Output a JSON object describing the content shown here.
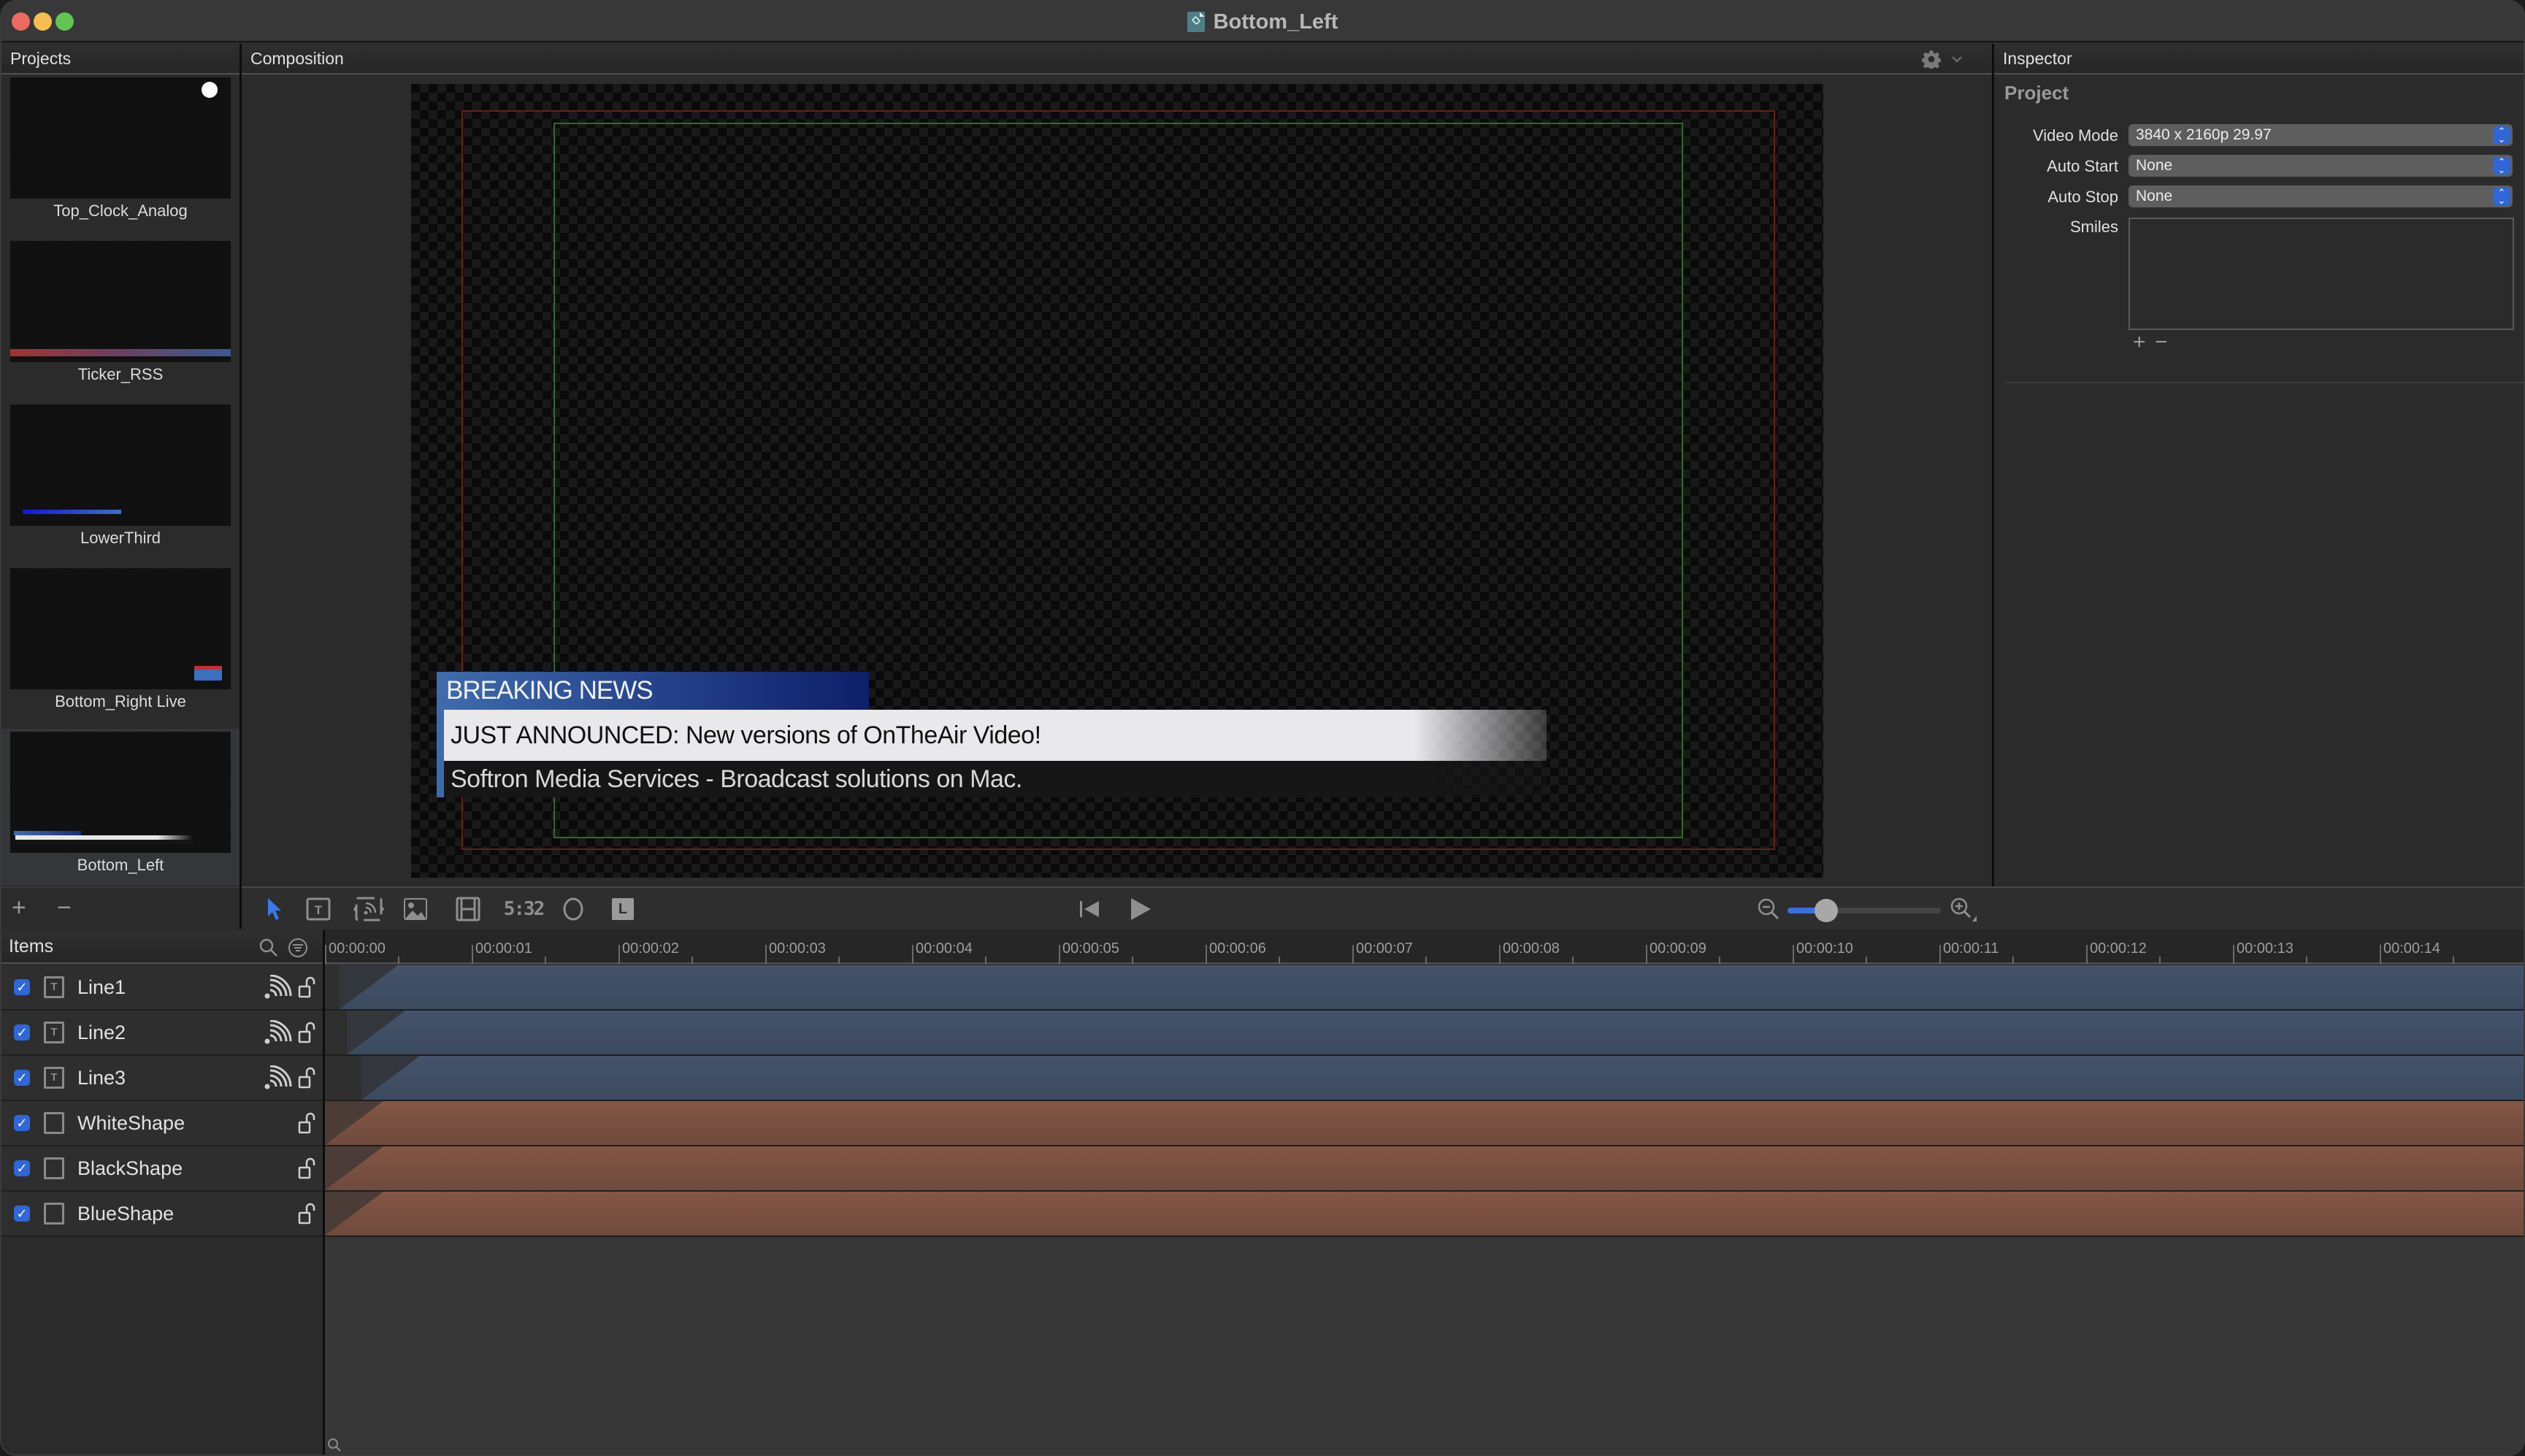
{
  "window": {
    "title": "Bottom_Left",
    "title_icon": "project-document-icon"
  },
  "panels": {
    "projects_header": "Projects",
    "composition_header": "Composition",
    "inspector_header": "Inspector"
  },
  "projects": {
    "items": [
      {
        "name": "Top_Clock_Analog",
        "thumbnail": "clock",
        "selected": false
      },
      {
        "name": "Ticker_RSS",
        "thumbnail": "ticker",
        "selected": false
      },
      {
        "name": "LowerThird",
        "thumbnail": "lowerthird",
        "selected": false
      },
      {
        "name": "Bottom_Right Live",
        "thumbnail": "live",
        "selected": false
      },
      {
        "name": "Bottom_Left",
        "thumbnail": "bottomleft",
        "selected": true
      }
    ],
    "add_label": "+",
    "remove_label": "−"
  },
  "composition": {
    "lower_third": {
      "title": "BREAKING NEWS",
      "line1": "JUST ANNOUNCED: New versions of OnTheAir Video!",
      "line2": "Softron Media Services -  Broadcast solutions on Mac."
    },
    "colors": {
      "safe_action": "#6b1c1c",
      "safe_title": "#2f6a26",
      "title_bar_blue": "#3f6cae"
    }
  },
  "toolbar": {
    "tools": [
      {
        "name": "select-tool",
        "icon": "arrow-pointer-icon",
        "active": true
      },
      {
        "name": "text-tool",
        "icon": "text-box-icon"
      },
      {
        "name": "rss-tool",
        "icon": "rss-feed-icon"
      },
      {
        "name": "image-tool",
        "icon": "image-icon"
      },
      {
        "name": "video-tool",
        "icon": "film-icon"
      },
      {
        "name": "clock-tool",
        "icon": "digital-clock-icon",
        "label": "5:32"
      },
      {
        "name": "shape-tool",
        "icon": "ellipse-icon"
      },
      {
        "name": "logo-tool",
        "icon": "l-badge-icon",
        "label": "L"
      }
    ],
    "transport": {
      "rewind": "skip-to-start-icon",
      "play": "play-icon"
    },
    "zoom_slider_value": 0.25
  },
  "timeline": {
    "items_header": "Items",
    "ruler_labels": [
      "00:00:00",
      "00:00:01",
      "00:00:02",
      "00:00:03",
      "00:00:04",
      "00:00:05",
      "00:00:06",
      "00:00:07",
      "00:00:08",
      "00:00:09",
      "00:00:10",
      "00:00:11",
      "00:00:12",
      "00:00:13",
      "00:00:14"
    ],
    "items": [
      {
        "name": "Line1",
        "type": "text",
        "enabled": true,
        "has_animation": true,
        "locked": false,
        "clip_start_sec": 0.1,
        "fade_end_sec": 0.5
      },
      {
        "name": "Line2",
        "type": "text",
        "enabled": true,
        "has_animation": true,
        "locked": false,
        "clip_start_sec": 0.15,
        "fade_end_sec": 0.55
      },
      {
        "name": "Line3",
        "type": "text",
        "enabled": true,
        "has_animation": true,
        "locked": false,
        "clip_start_sec": 0.25,
        "fade_end_sec": 0.65
      },
      {
        "name": "WhiteShape",
        "type": "shape",
        "enabled": true,
        "has_animation": false,
        "locked": false,
        "clip_start_sec": 0,
        "fade_end_sec": 0.4
      },
      {
        "name": "BlackShape",
        "type": "shape",
        "enabled": true,
        "has_animation": false,
        "locked": false,
        "clip_start_sec": 0,
        "fade_end_sec": 0.4
      },
      {
        "name": "BlueShape",
        "type": "shape",
        "enabled": true,
        "has_animation": false,
        "locked": false,
        "clip_start_sec": 0,
        "fade_end_sec": 0.4
      }
    ],
    "colors": {
      "text_clip": "#44536a",
      "shape_clip": "#845645"
    }
  },
  "inspector": {
    "section": "Project",
    "video_mode_label": "Video Mode",
    "video_mode_value": "3840 x 2160p 29.97",
    "auto_start_label": "Auto Start",
    "auto_start_value": "None",
    "auto_stop_label": "Auto Stop",
    "auto_stop_value": "None",
    "smiles_label": "Smiles",
    "smiles_add": "+",
    "smiles_remove": "−"
  }
}
